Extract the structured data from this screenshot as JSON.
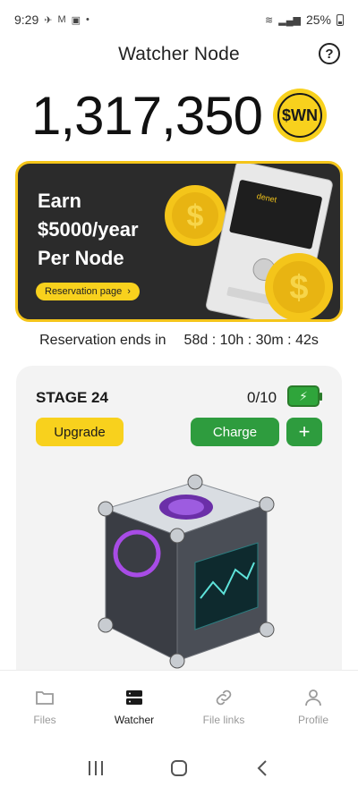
{
  "status_bar": {
    "time": "9:29",
    "battery": "25%"
  },
  "header": {
    "title": "Watcher Node"
  },
  "balance": {
    "value": "1,317,350",
    "coin_label": "$WN"
  },
  "banner": {
    "line1": "Earn",
    "line2": "$5000/year",
    "line3": "Per Node",
    "button_label": "Reservation page",
    "device_brand": "denet"
  },
  "reservation": {
    "label": "Reservation ends in",
    "countdown": "58d : 10h : 30m : 42s"
  },
  "stage": {
    "title": "STAGE 24",
    "count": "0/10",
    "upgrade_label": "Upgrade",
    "charge_label": "Charge",
    "plus_label": "+"
  },
  "nav": {
    "items": [
      {
        "label": "Files",
        "icon": "folder-icon"
      },
      {
        "label": "Watcher",
        "icon": "server-icon"
      },
      {
        "label": "File links",
        "icon": "link-icon"
      },
      {
        "label": "Profile",
        "icon": "user-icon"
      }
    ],
    "active": "Watcher"
  },
  "colors": {
    "accent_yellow": "#f8d11d",
    "accent_green": "#2e9c3e",
    "banner_bg": "#2b2b2b"
  }
}
